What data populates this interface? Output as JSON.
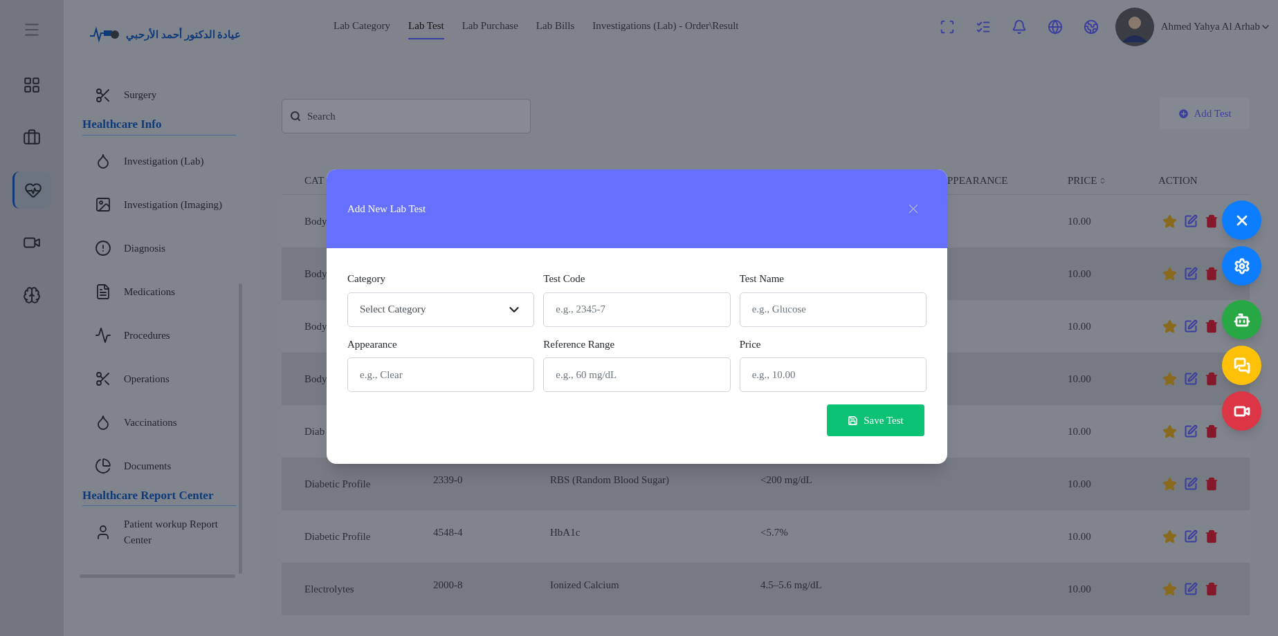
{
  "rail": {
    "items": [
      {
        "selected": false
      },
      {
        "selected": false
      },
      {
        "selected": true
      },
      {
        "selected": false
      },
      {
        "selected": false
      }
    ]
  },
  "sidebar": {
    "clinic_name": "عيادة الدكتور أحمد الأرحبي",
    "items": [
      {
        "label": "Surgery"
      }
    ],
    "sections": [
      {
        "title": "Healthcare Info",
        "items": [
          {
            "label": "Investigation (Lab)"
          },
          {
            "label": "Investigation (Imaging)"
          },
          {
            "label": "Diagnosis"
          },
          {
            "label": "Medications"
          },
          {
            "label": "Procedures"
          },
          {
            "label": "Operations"
          },
          {
            "label": "Vaccinations"
          },
          {
            "label": "Documents"
          }
        ]
      },
      {
        "title": "Healthcare Report Center",
        "items": [
          {
            "label": "Patient workup Report Center"
          }
        ]
      }
    ]
  },
  "tabs": [
    {
      "label": "Lab Category",
      "selected": false
    },
    {
      "label": "Lab Test",
      "selected": true
    },
    {
      "label": "Lab Purchase",
      "selected": false
    },
    {
      "label": "Lab Bills",
      "selected": false
    },
    {
      "label": "Investigations (Lab) - Order\\Result",
      "selected": false
    }
  ],
  "user": {
    "name": "Ahmed Yahya Al Arhab"
  },
  "search": {
    "placeholder": "Search"
  },
  "add_button": "Add Test",
  "table": {
    "columns": [
      {
        "label": "CAT",
        "sortable": false
      },
      {
        "label": "PPEARANCE",
        "sortable": false
      },
      {
        "label": "PRICE",
        "sortable": true
      },
      {
        "label": "ACTION",
        "sortable": false
      }
    ],
    "rows": [
      {
        "category": "Body",
        "price": "10.00"
      },
      {
        "category": "Body",
        "price": "10.00"
      },
      {
        "category": "Body",
        "price": "10.00"
      },
      {
        "category": "Body",
        "price": "10.00"
      },
      {
        "category": "Diab",
        "price": "10.00"
      },
      {
        "category": "Diabetic Profile",
        "code": "2339-0",
        "name": "RBS (Random Blood Sugar)",
        "range": "<200 mg/dL",
        "price": "10.00"
      },
      {
        "category": "Diabetic Profile",
        "code": "4548-4",
        "name": "HbA1c",
        "range": "<5.7%",
        "price": "10.00"
      },
      {
        "category": "Electrolytes",
        "code": "2000-8",
        "name": "Ionized Calcium",
        "range": "4.5–5.6 mg/dL",
        "price": "10.00"
      }
    ]
  },
  "modal": {
    "title": "Add New Lab Test",
    "fields": [
      {
        "label": "Category",
        "kind": "select",
        "placeholder": "Select Category"
      },
      {
        "label": "Test Code",
        "kind": "text",
        "placeholder": "e.g., 2345-7"
      },
      {
        "label": "Test Name",
        "kind": "text",
        "placeholder": "e.g., Glucose"
      },
      {
        "label": "Appearance",
        "kind": "text",
        "placeholder": "e.g., Clear"
      },
      {
        "label": "Reference Range",
        "kind": "text",
        "placeholder": "e.g., 60 mg/dL"
      },
      {
        "label": "Price",
        "kind": "text",
        "placeholder": "e.g., 10.00"
      }
    ],
    "save_button": "Save Test"
  },
  "floating_buttons": [
    {
      "color": "#0d7dff"
    },
    {
      "color": "#0d7dff"
    },
    {
      "color": "#28a745"
    },
    {
      "color": "#ffc107"
    },
    {
      "color": "#dc3545"
    }
  ]
}
